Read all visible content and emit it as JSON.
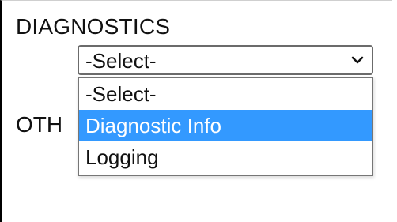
{
  "sections": {
    "diagnostics_label": "DIAGNOSTICS",
    "other_label_visible": "OTH"
  },
  "select": {
    "value": "-Select-",
    "open": true,
    "options": [
      {
        "label": "-Select-",
        "highlighted": false
      },
      {
        "label": "Diagnostic Info",
        "highlighted": true
      },
      {
        "label": "Logging",
        "highlighted": false
      }
    ],
    "icon": "chevron-down-icon"
  },
  "colors": {
    "highlight": "#3399ff",
    "highlight_text": "#ffffff"
  }
}
